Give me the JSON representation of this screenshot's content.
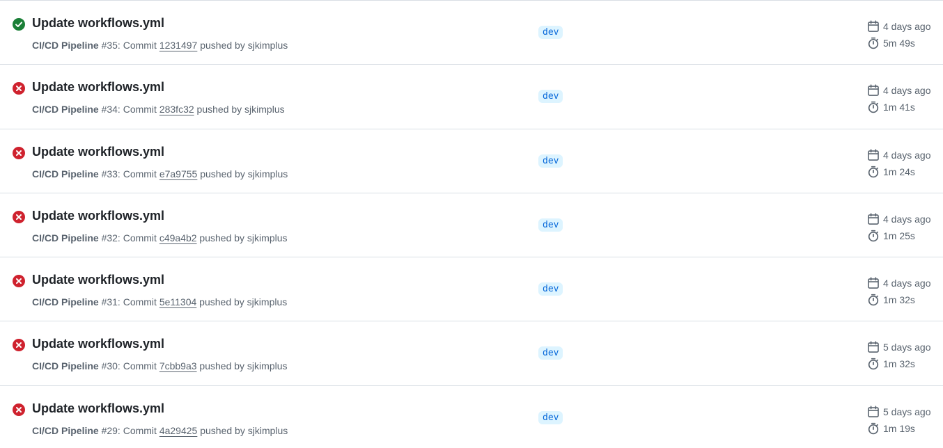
{
  "colors": {
    "success": "#1a7f37",
    "failure": "#cf222e",
    "branch_bg": "#ddf4ff",
    "branch_fg": "#0969da"
  },
  "icons": {
    "success": "check-circle-icon",
    "failure": "x-circle-icon",
    "date": "calendar-icon",
    "duration": "stopwatch-icon"
  },
  "runs": [
    {
      "status": "success",
      "title": "Update workflows.yml",
      "workflow": "CI/CD Pipeline",
      "number_text": " #35: Commit ",
      "commit": "1231497",
      "pushed_by": " pushed by sjkimplus",
      "branch": "dev",
      "date": "4 days ago",
      "duration": "5m 49s"
    },
    {
      "status": "failure",
      "title": "Update workflows.yml",
      "workflow": "CI/CD Pipeline",
      "number_text": " #34: Commit ",
      "commit": "283fc32",
      "pushed_by": " pushed by sjkimplus",
      "branch": "dev",
      "date": "4 days ago",
      "duration": "1m 41s"
    },
    {
      "status": "failure",
      "title": "Update workflows.yml",
      "workflow": "CI/CD Pipeline",
      "number_text": " #33: Commit ",
      "commit": "e7a9755",
      "pushed_by": " pushed by sjkimplus",
      "branch": "dev",
      "date": "4 days ago",
      "duration": "1m 24s"
    },
    {
      "status": "failure",
      "title": "Update workflows.yml",
      "workflow": "CI/CD Pipeline",
      "number_text": " #32: Commit ",
      "commit": "c49a4b2",
      "pushed_by": " pushed by sjkimplus",
      "branch": "dev",
      "date": "4 days ago",
      "duration": "1m 25s"
    },
    {
      "status": "failure",
      "title": "Update workflows.yml",
      "workflow": "CI/CD Pipeline",
      "number_text": " #31: Commit ",
      "commit": "5e11304",
      "pushed_by": " pushed by sjkimplus",
      "branch": "dev",
      "date": "4 days ago",
      "duration": "1m 32s"
    },
    {
      "status": "failure",
      "title": "Update workflows.yml",
      "workflow": "CI/CD Pipeline",
      "number_text": " #30: Commit ",
      "commit": "7cbb9a3",
      "pushed_by": " pushed by sjkimplus",
      "branch": "dev",
      "date": "5 days ago",
      "duration": "1m 32s"
    },
    {
      "status": "failure",
      "title": "Update workflows.yml",
      "workflow": "CI/CD Pipeline",
      "number_text": " #29: Commit ",
      "commit": "4a29425",
      "pushed_by": " pushed by sjkimplus",
      "branch": "dev",
      "date": "5 days ago",
      "duration": "1m 19s"
    }
  ]
}
